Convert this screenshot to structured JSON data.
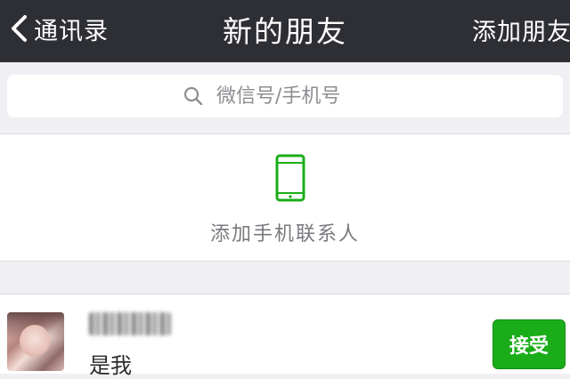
{
  "navbar": {
    "back_label": "通讯录",
    "title": "新的朋友",
    "right_action": "添加朋友"
  },
  "search": {
    "placeholder": "微信号/手机号",
    "icon": "search-icon"
  },
  "add_contacts": {
    "label": "添加手机联系人",
    "icon": "phone-icon",
    "icon_color": "#1aad19"
  },
  "friend_requests": [
    {
      "name": "",
      "message": "是我",
      "action_label": "接受",
      "action_color": "#1aad19"
    }
  ]
}
